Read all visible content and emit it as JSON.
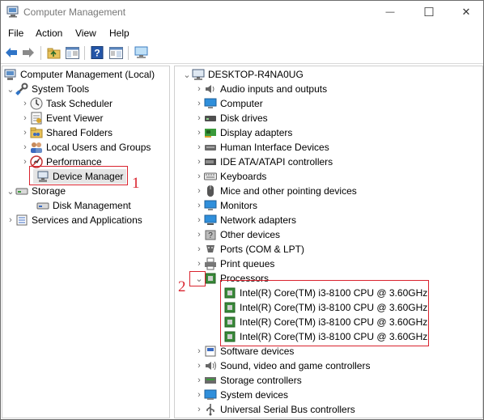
{
  "window": {
    "title": "Computer Management",
    "controls": {
      "minimize": "—",
      "maximize": "☐",
      "close": "✕"
    }
  },
  "menubar": {
    "items": [
      "File",
      "Action",
      "View",
      "Help"
    ]
  },
  "toolbar": {
    "buttons": [
      "back-icon",
      "forward-icon",
      "up-folder-icon",
      "show-hide-tree-icon",
      "help-icon",
      "properties-icon",
      "monitor-icon"
    ]
  },
  "left_tree": {
    "root": "Computer Management (Local)",
    "system_tools": "System Tools",
    "task_scheduler": "Task Scheduler",
    "event_viewer": "Event Viewer",
    "shared_folders": "Shared Folders",
    "local_users": "Local Users and Groups",
    "performance": "Performance",
    "device_manager": "Device Manager",
    "storage": "Storage",
    "disk_management": "Disk Management",
    "services_apps": "Services and Applications"
  },
  "device_tree": {
    "computer_name": "DESKTOP-R4NA0UG",
    "categories": [
      "Audio inputs and outputs",
      "Computer",
      "Disk drives",
      "Display adapters",
      "Human Interface Devices",
      "IDE ATA/ATAPI controllers",
      "Keyboards",
      "Mice and other pointing devices",
      "Monitors",
      "Network adapters",
      "Other devices",
      "Ports (COM & LPT)",
      "Print queues",
      "Processors"
    ],
    "processors": [
      "Intel(R) Core(TM) i3-8100 CPU @ 3.60GHz",
      "Intel(R) Core(TM) i3-8100 CPU @ 3.60GHz",
      "Intel(R) Core(TM) i3-8100 CPU @ 3.60GHz",
      "Intel(R) Core(TM) i3-8100 CPU @ 3.60GHz"
    ],
    "categories_after": [
      "Software devices",
      "Sound, video and game controllers",
      "Storage controllers",
      "System devices",
      "Universal Serial Bus controllers"
    ]
  },
  "annotations": {
    "step1": "1",
    "step2": "2"
  },
  "colors": {
    "annotation_red": "#d9232e",
    "selected_bg": "#e5e5e5"
  }
}
